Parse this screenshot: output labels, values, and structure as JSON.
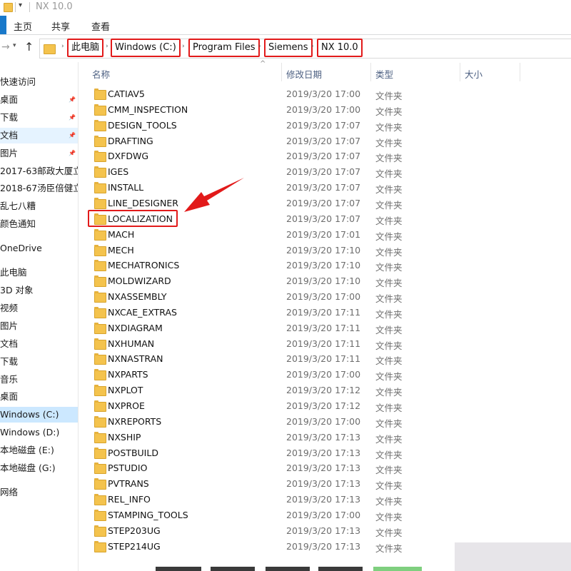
{
  "window": {
    "title": "NX 10.0"
  },
  "ribbon": {
    "tabs": [
      "主页",
      "共享",
      "查看"
    ]
  },
  "address": {
    "breadcrumbs": [
      "此电脑",
      "Windows (C:)",
      "Program Files",
      "Siemens",
      "NX 10.0"
    ]
  },
  "nav": {
    "items": [
      {
        "label": "快速访问",
        "pinned": false,
        "state": ""
      },
      {
        "label": "桌面",
        "pinned": true,
        "state": ""
      },
      {
        "label": "下载",
        "pinned": true,
        "state": ""
      },
      {
        "label": "文档",
        "pinned": true,
        "state": "hl"
      },
      {
        "label": "图片",
        "pinned": true,
        "state": ""
      },
      {
        "label": "2017-63邮政大厦立",
        "pinned": false,
        "state": ""
      },
      {
        "label": "2018-67汤臣倍健立",
        "pinned": false,
        "state": ""
      },
      {
        "label": "乱七八糟",
        "pinned": false,
        "state": ""
      },
      {
        "label": "颜色通知",
        "pinned": false,
        "state": ""
      },
      {
        "label": "OneDrive",
        "pinned": false,
        "state": "gap"
      },
      {
        "label": "此电脑",
        "pinned": false,
        "state": "gap"
      },
      {
        "label": "3D 对象",
        "pinned": false,
        "state": ""
      },
      {
        "label": "视频",
        "pinned": false,
        "state": ""
      },
      {
        "label": "图片",
        "pinned": false,
        "state": ""
      },
      {
        "label": "文档",
        "pinned": false,
        "state": ""
      },
      {
        "label": "下载",
        "pinned": false,
        "state": ""
      },
      {
        "label": "音乐",
        "pinned": false,
        "state": ""
      },
      {
        "label": "桌面",
        "pinned": false,
        "state": ""
      },
      {
        "label": "Windows (C:)",
        "pinned": false,
        "state": "sel"
      },
      {
        "label": "Windows (D:)",
        "pinned": false,
        "state": ""
      },
      {
        "label": "本地磁盘 (E:)",
        "pinned": false,
        "state": ""
      },
      {
        "label": "本地磁盘 (G:)",
        "pinned": false,
        "state": ""
      },
      {
        "label": "网络",
        "pinned": false,
        "state": "gap"
      }
    ]
  },
  "list": {
    "columns": [
      "名称",
      "修改日期",
      "类型",
      "大小"
    ],
    "rows": [
      {
        "name": "CATIAV5",
        "date": "2019/3/20 17:00",
        "type": "文件夹"
      },
      {
        "name": "CMM_INSPECTION",
        "date": "2019/3/20 17:00",
        "type": "文件夹"
      },
      {
        "name": "DESIGN_TOOLS",
        "date": "2019/3/20 17:07",
        "type": "文件夹"
      },
      {
        "name": "DRAFTING",
        "date": "2019/3/20 17:07",
        "type": "文件夹"
      },
      {
        "name": "DXFDWG",
        "date": "2019/3/20 17:07",
        "type": "文件夹"
      },
      {
        "name": "IGES",
        "date": "2019/3/20 17:07",
        "type": "文件夹"
      },
      {
        "name": "INSTALL",
        "date": "2019/3/20 17:07",
        "type": "文件夹"
      },
      {
        "name": "LINE_DESIGNER",
        "date": "2019/3/20 17:07",
        "type": "文件夹"
      },
      {
        "name": "LOCALIZATION",
        "date": "2019/3/20 17:07",
        "type": "文件夹",
        "highlight": true
      },
      {
        "name": "MACH",
        "date": "2019/3/20 17:01",
        "type": "文件夹"
      },
      {
        "name": "MECH",
        "date": "2019/3/20 17:10",
        "type": "文件夹"
      },
      {
        "name": "MECHATRONICS",
        "date": "2019/3/20 17:10",
        "type": "文件夹"
      },
      {
        "name": "MOLDWIZARD",
        "date": "2019/3/20 17:10",
        "type": "文件夹"
      },
      {
        "name": "NXASSEMBLY",
        "date": "2019/3/20 17:00",
        "type": "文件夹"
      },
      {
        "name": "NXCAE_EXTRAS",
        "date": "2019/3/20 17:11",
        "type": "文件夹"
      },
      {
        "name": "NXDIAGRAM",
        "date": "2019/3/20 17:11",
        "type": "文件夹"
      },
      {
        "name": "NXHUMAN",
        "date": "2019/3/20 17:11",
        "type": "文件夹"
      },
      {
        "name": "NXNASTRAN",
        "date": "2019/3/20 17:11",
        "type": "文件夹"
      },
      {
        "name": "NXPARTS",
        "date": "2019/3/20 17:00",
        "type": "文件夹"
      },
      {
        "name": "NXPLOT",
        "date": "2019/3/20 17:12",
        "type": "文件夹"
      },
      {
        "name": "NXPROE",
        "date": "2019/3/20 17:12",
        "type": "文件夹"
      },
      {
        "name": "NXREPORTS",
        "date": "2019/3/20 17:00",
        "type": "文件夹"
      },
      {
        "name": "NXSHIP",
        "date": "2019/3/20 17:13",
        "type": "文件夹"
      },
      {
        "name": "POSTBUILD",
        "date": "2019/3/20 17:13",
        "type": "文件夹"
      },
      {
        "name": "PSTUDIO",
        "date": "2019/3/20 17:13",
        "type": "文件夹"
      },
      {
        "name": "PVTRANS",
        "date": "2019/3/20 17:13",
        "type": "文件夹"
      },
      {
        "name": "REL_INFO",
        "date": "2019/3/20 17:13",
        "type": "文件夹"
      },
      {
        "name": "STAMPING_TOOLS",
        "date": "2019/3/20 17:00",
        "type": "文件夹"
      },
      {
        "name": "STEP203UG",
        "date": "2019/3/20 17:13",
        "type": "文件夹"
      },
      {
        "name": "STEP214UG",
        "date": "2019/3/20 17:13",
        "type": "文件夹"
      }
    ]
  },
  "colors": {
    "annotation_red": "#e21a1a",
    "folder_yellow": "#f4c34d",
    "selection_blue": "#cce8ff"
  }
}
